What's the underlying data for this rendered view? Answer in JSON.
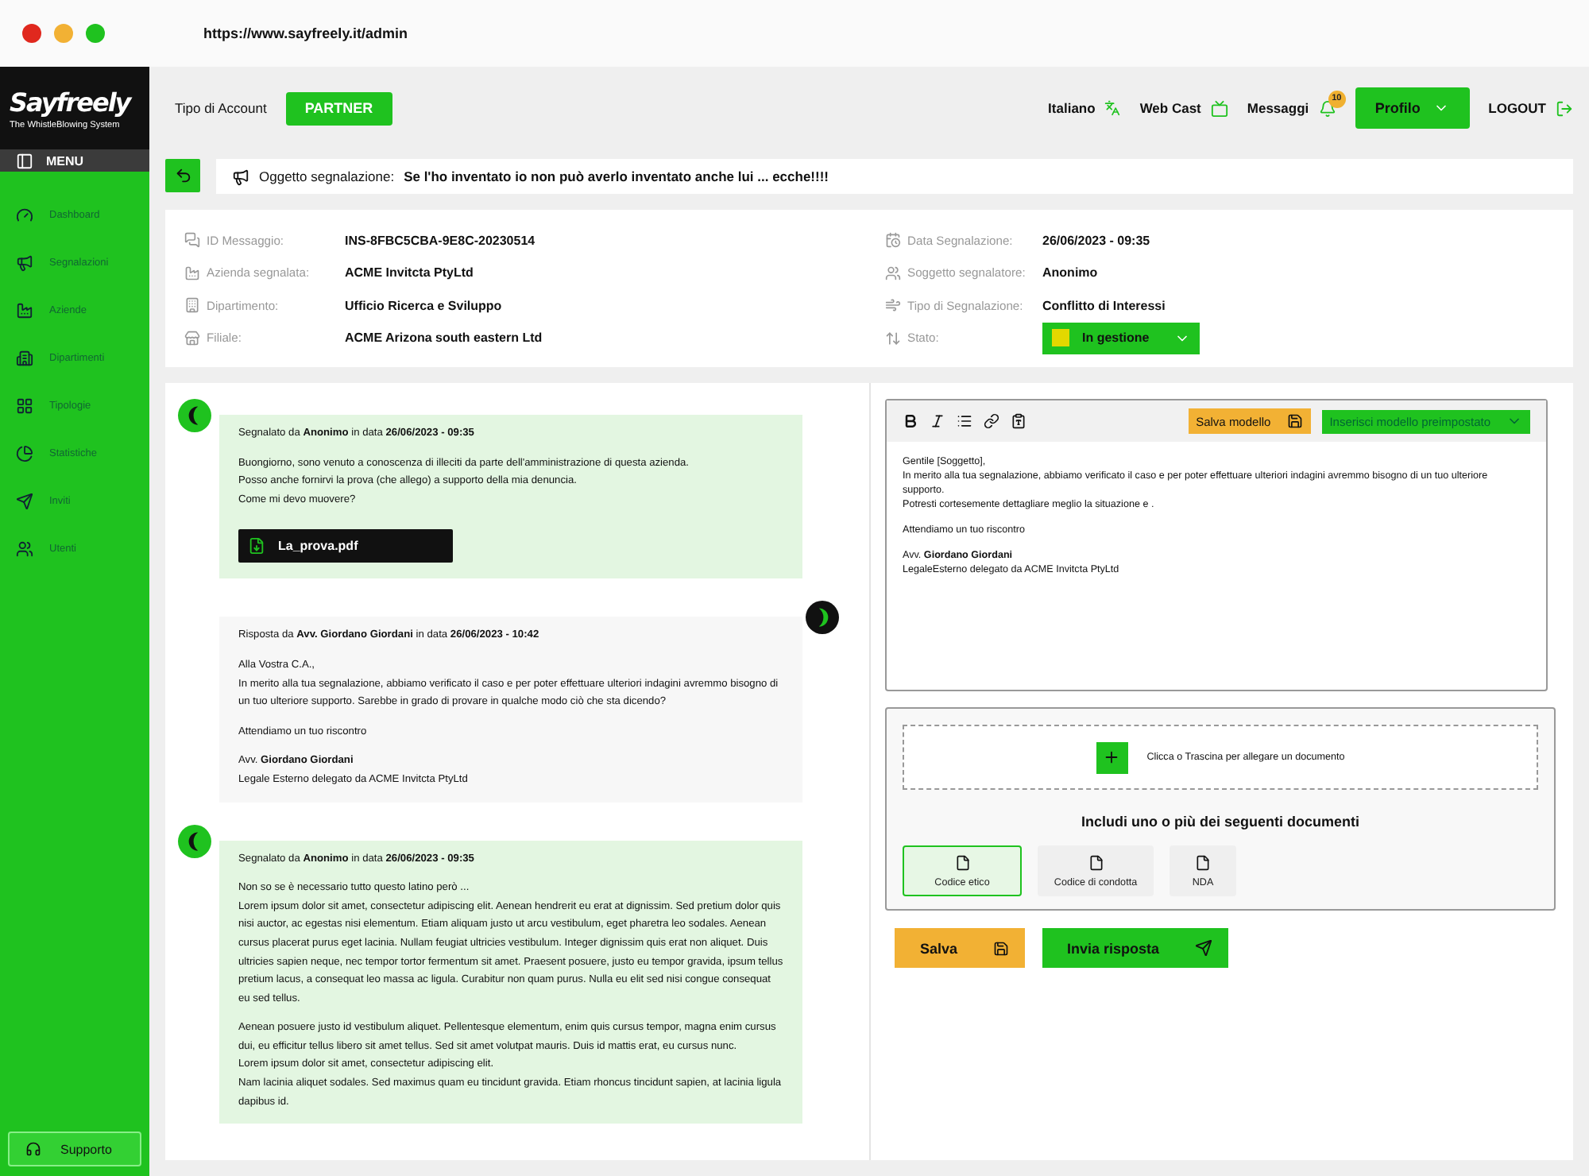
{
  "browser": {
    "url": "https://www.sayfreely.it/admin"
  },
  "sidebar": {
    "logo": "Sayfreely",
    "tagline": "The WhistleBlowing System",
    "menu_label": "MENU",
    "items": [
      {
        "label": "Dashboard"
      },
      {
        "label": "Segnalazioni"
      },
      {
        "label": "Aziende"
      },
      {
        "label": "Dipartimenti"
      },
      {
        "label": "Tipologie"
      },
      {
        "label": "Statistiche"
      },
      {
        "label": "Inviti"
      },
      {
        "label": "Utenti"
      }
    ],
    "support": "Supporto"
  },
  "header": {
    "account_label": "Tipo di Account",
    "account_type": "PARTNER",
    "language": "Italiano",
    "webcast": "Web Cast",
    "messages": "Messaggi",
    "messages_badge": "10",
    "profile": "Profilo",
    "logout": "LOGOUT"
  },
  "subject": {
    "label": "Oggetto segnalazione:",
    "value": "Se l'ho inventato io non può averlo inventato anche lui ... ecche!!!!"
  },
  "details": {
    "left": [
      {
        "label": "ID Messaggio:",
        "value": "INS-8FBC5CBA-9E8C-20230514"
      },
      {
        "label": "Azienda segnalata:",
        "value": "ACME Invitcta PtyLtd"
      },
      {
        "label": "Dipartimento:",
        "value": "Ufficio Ricerca e Sviluppo"
      },
      {
        "label": "Filiale:",
        "value": "ACME Arizona south eastern Ltd"
      }
    ],
    "right": [
      {
        "kind": "text",
        "label": "Data Segnalazione:",
        "value": "26/06/2023 - 09:35"
      },
      {
        "kind": "text",
        "label": "Soggetto segnalatore:",
        "value": "Anonimo"
      },
      {
        "kind": "text",
        "label": "Tipo di Segnalazione:",
        "value": "Conflitto di Interessi"
      },
      {
        "kind": "select",
        "label": "Stato:",
        "value": "In gestione",
        "color": "#e3d800"
      }
    ]
  },
  "messages": [
    {
      "kind": "report",
      "header": "Segnalato da **Anonimo** in data **26/06/2023 - 09:35**",
      "paragraphs": [
        [
          "Buongiorno, sono venuto a conoscenza di illeciti da parte dell'amministrazione di questa azienda.",
          "Posso anche fornirvi la prova (che allego) a supporto della mia denuncia.",
          "Come mi devo muovere?"
        ]
      ],
      "attachment": "La_prova.pdf"
    },
    {
      "kind": "reply",
      "header": "Risposta da **Avv. Giordano Giordani** in data **26/06/2023 - 10:42**",
      "paragraphs": [
        [
          "Alla Vostra C.A.,",
          "In merito alla tua segnalazione, abbiamo verificato il caso e per poter effettuare ulteriori indagini avremmo bisogno di un tuo ulteriore supporto. Sarebbe in grado di provare in qualche modo ciò che sta dicendo?"
        ],
        [
          "Attendiamo un tuo riscontro"
        ],
        [
          "Avv. **Giordano Giordani**",
          "Legale Esterno delegato da ACME Invitcta PtyLtd"
        ]
      ]
    },
    {
      "kind": "report",
      "header": "Segnalato da **Anonimo** in data **26/06/2023 - 09:35**",
      "paragraphs": [
        [
          "Non so se è necessario tutto questo latino però ...",
          "Lorem ipsum dolor sit amet, consectetur adipiscing elit. Aenean hendrerit eu erat at dignissim. Sed pretium dolor quis nisi auctor, ac egestas nisi elementum. Etiam aliquam justo ut arcu vestibulum, eget pharetra leo sodales. Aenean cursus placerat purus eget lacinia. Nullam feugiat ultricies vestibulum. Integer dignissim quis erat non aliquet. Duis ultricies sapien neque, nec tempor tortor fermentum sit amet. Praesent posuere, justo eu tempor gravida, ipsum tellus pretium lacus, a consequat leo massa ac ligula. Curabitur non quam purus. Nulla eu elit sed nisi congue consequat eu sed tellus."
        ],
        [
          "Aenean posuere justo id vestibulum aliquet. Pellentesque elementum, enim quis cursus tempor, magna enim cursus dui, eu efficitur tellus libero sit amet tellus. Sed sit amet volutpat mauris. Duis id mattis erat, eu cursus nunc.",
          "Lorem ipsum dolor sit amet, consectetur adipiscing elit.",
          "Nam lacinia aliquet sodales. Sed maximus quam eu tincidunt gravida. Etiam rhoncus tincidunt sapien, at lacinia ligula dapibus id."
        ]
      ]
    }
  ],
  "editor": {
    "save_template": "Salva modello",
    "insert_template": "Inserisci modello preimpostato",
    "paragraphs": [
      [
        "Gentile [Soggetto],",
        "In merito alla tua segnalazione, abbiamo verificato il caso e per poter effettuare ulteriori indagini avremmo bisogno di un tuo ulteriore supporto.",
        "Potresti cortesemente dettagliare meglio la situazione e ."
      ],
      [
        "Attendiamo un tuo riscontro"
      ],
      [
        "Avv. **Giordano Giordani**",
        "LegaleEsterno delegato da ACME Invitcta PtyLtd"
      ]
    ]
  },
  "attachments": {
    "dropzone": "Clicca o Trascina per allegare un documento",
    "documents_title": "Includi uno o più dei seguenti documenti",
    "documents": [
      {
        "label": "Codice etico",
        "selected": true
      },
      {
        "label": "Codice di condotta",
        "selected": false
      },
      {
        "label": "NDA",
        "selected": false
      }
    ]
  },
  "actions": {
    "save": "Salva",
    "send": "Invia risposta"
  }
}
